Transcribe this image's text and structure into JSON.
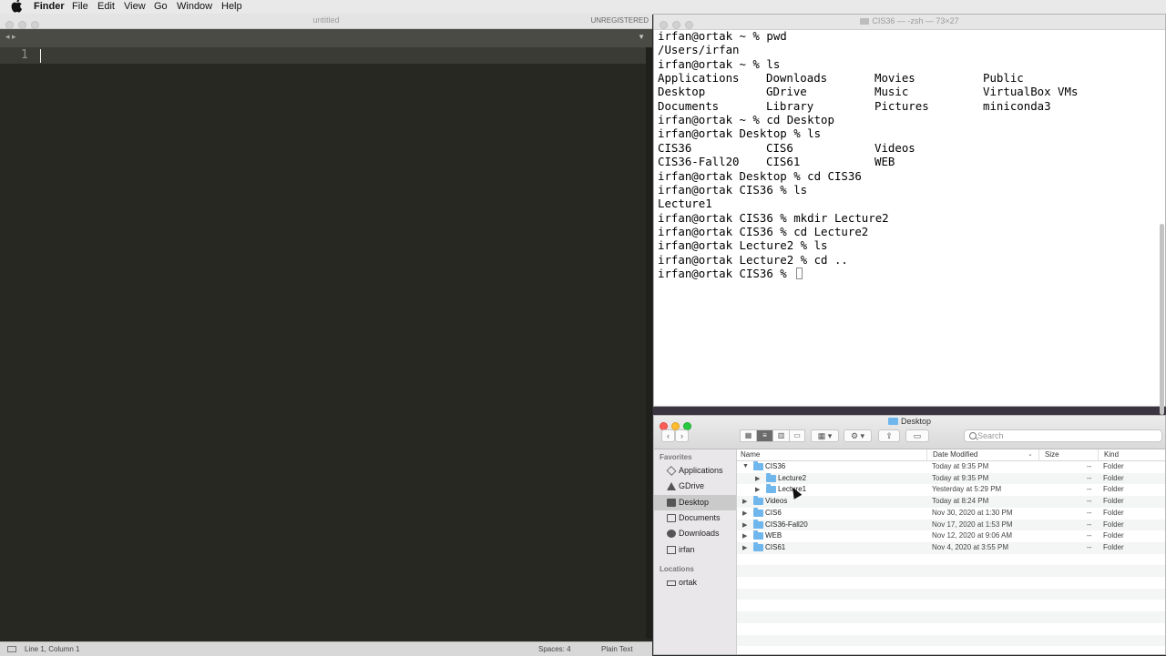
{
  "menubar": {
    "app_name": "Finder",
    "items": [
      "File",
      "Edit",
      "View",
      "Go",
      "Window",
      "Help"
    ]
  },
  "editor": {
    "title": "untitled",
    "badge": "UNREGISTERED",
    "line_number": "1",
    "status": {
      "position": "Line 1, Column 1",
      "spaces": "Spaces: 4",
      "syntax": "Plain Text"
    }
  },
  "terminal": {
    "title": "CIS36 — -zsh — 73×27",
    "lines": [
      [
        "irfan@ortak ~ % pwd"
      ],
      [
        "/Users/irfan"
      ],
      [
        "irfan@ortak ~ % ls"
      ],
      [
        "Applications",
        "Downloads",
        "Movies",
        "Public"
      ],
      [
        "Desktop",
        "GDrive",
        "Music",
        "VirtualBox VMs"
      ],
      [
        "Documents",
        "Library",
        "Pictures",
        "miniconda3"
      ],
      [
        "irfan@ortak ~ % cd Desktop"
      ],
      [
        "irfan@ortak Desktop % ls"
      ],
      [
        "CIS36",
        "CIS6",
        "Videos"
      ],
      [
        "CIS36-Fall20",
        "CIS61",
        "WEB"
      ],
      [
        "irfan@ortak Desktop % cd CIS36"
      ],
      [
        "irfan@ortak CIS36 % ls"
      ],
      [
        "Lecture1"
      ],
      [
        "irfan@ortak CIS36 % mkdir Lecture2"
      ],
      [
        "irfan@ortak CIS36 % cd Lecture2"
      ],
      [
        "irfan@ortak Lecture2 % ls"
      ],
      [
        "irfan@ortak Lecture2 % cd .."
      ],
      [
        "irfan@ortak CIS36 % "
      ]
    ]
  },
  "finder": {
    "title": "Desktop",
    "search_placeholder": "Search",
    "sidebar": {
      "favorites_heading": "Favorites",
      "favorites": [
        {
          "label": "Applications",
          "icon": "applications-icon"
        },
        {
          "label": "GDrive",
          "icon": "gdrive-icon"
        },
        {
          "label": "Desktop",
          "icon": "desktop-icon",
          "selected": true
        },
        {
          "label": "Documents",
          "icon": "documents-icon"
        },
        {
          "label": "Downloads",
          "icon": "downloads-icon"
        },
        {
          "label": "irfan",
          "icon": "home-icon"
        }
      ],
      "locations_heading": "Locations",
      "locations": [
        {
          "label": "ortak",
          "icon": "disk-icon"
        }
      ]
    },
    "columns": {
      "name": "Name",
      "date": "Date Modified",
      "size": "Size",
      "kind": "Kind"
    },
    "rows": [
      {
        "name": "CIS36",
        "date": "Today at 9:35 PM",
        "size": "--",
        "kind": "Folder",
        "level": 0,
        "expanded": true
      },
      {
        "name": "Lecture2",
        "date": "Today at 9:35 PM",
        "size": "--",
        "kind": "Folder",
        "level": 1,
        "expanded": false
      },
      {
        "name": "Lecture1",
        "date": "Yesterday at 5:29 PM",
        "size": "--",
        "kind": "Folder",
        "level": 1,
        "expanded": false
      },
      {
        "name": "Videos",
        "date": "Today at 8:24 PM",
        "size": "--",
        "kind": "Folder",
        "level": 0,
        "expanded": false
      },
      {
        "name": "CIS6",
        "date": "Nov 30, 2020 at 1:30 PM",
        "size": "--",
        "kind": "Folder",
        "level": 0,
        "expanded": false
      },
      {
        "name": "CIS36-Fall20",
        "date": "Nov 17, 2020 at 1:53 PM",
        "size": "--",
        "kind": "Folder",
        "level": 0,
        "expanded": false
      },
      {
        "name": "WEB",
        "date": "Nov 12, 2020 at 9:06 AM",
        "size": "--",
        "kind": "Folder",
        "level": 0,
        "expanded": false
      },
      {
        "name": "CIS61",
        "date": "Nov 4, 2020 at 3:55 PM",
        "size": "--",
        "kind": "Folder",
        "level": 0,
        "expanded": false
      }
    ],
    "colors": {
      "folder": "#6fb6ec",
      "close": "#fd5e57",
      "minimize": "#febc2e",
      "zoom": "#28c840"
    }
  }
}
